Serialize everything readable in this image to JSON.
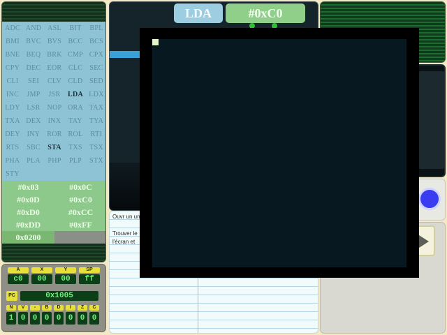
{
  "opcodes": [
    {
      "label": "ADC"
    },
    {
      "label": "AND"
    },
    {
      "label": "ASL"
    },
    {
      "label": "BIT"
    },
    {
      "label": "BPL"
    },
    {
      "label": "BMI"
    },
    {
      "label": "BVC"
    },
    {
      "label": "BVS"
    },
    {
      "label": "BCC"
    },
    {
      "label": "BCS"
    },
    {
      "label": "BNE"
    },
    {
      "label": "BEQ"
    },
    {
      "label": "BRK"
    },
    {
      "label": "CMP"
    },
    {
      "label": "CPX"
    },
    {
      "label": "CPY"
    },
    {
      "label": "DEC"
    },
    {
      "label": "EOR"
    },
    {
      "label": "CLC"
    },
    {
      "label": "SEC"
    },
    {
      "label": "CLI"
    },
    {
      "label": "SEI"
    },
    {
      "label": "CLV"
    },
    {
      "label": "CLD"
    },
    {
      "label": "SED"
    },
    {
      "label": "INC"
    },
    {
      "label": "JMP"
    },
    {
      "label": "JSR"
    },
    {
      "label": "LDA",
      "active": true
    },
    {
      "label": "LDX"
    },
    {
      "label": "LDY"
    },
    {
      "label": "LSR"
    },
    {
      "label": "NOP"
    },
    {
      "label": "ORA"
    },
    {
      "label": "TAX"
    },
    {
      "label": "TXA"
    },
    {
      "label": "DEX"
    },
    {
      "label": "INX"
    },
    {
      "label": "TAY"
    },
    {
      "label": "TYA"
    },
    {
      "label": "DEY"
    },
    {
      "label": "INY"
    },
    {
      "label": "ROR"
    },
    {
      "label": "ROL"
    },
    {
      "label": "RTI"
    },
    {
      "label": "RTS"
    },
    {
      "label": "SBC"
    },
    {
      "label": "STA",
      "active": true
    },
    {
      "label": "TXS"
    },
    {
      "label": "TSX"
    },
    {
      "label": "PHA"
    },
    {
      "label": "PLA"
    },
    {
      "label": "PHP"
    },
    {
      "label": "PLP"
    },
    {
      "label": "STX"
    },
    {
      "label": "STY"
    }
  ],
  "operands": [
    "#0x03",
    "#0x0C",
    "#0x0D",
    "#0xC0",
    "#0xD0",
    "#0xCC",
    "#0xDD",
    "#0xFF"
  ],
  "address": "0x0200",
  "current_instruction": {
    "opcode": "LDA",
    "operand": "#0xC0"
  },
  "registers": {
    "labels": [
      "A",
      "X",
      "Y",
      "SP"
    ],
    "values": [
      "c0",
      "00",
      "00",
      "ff"
    ],
    "pc_label": "PC",
    "pc": "0x1005",
    "flag_labels": [
      "N",
      "V",
      "-",
      "B",
      "D",
      "I",
      "Z",
      "C"
    ],
    "flags": [
      "1",
      "0",
      "0",
      "0",
      "0",
      "0",
      "0",
      "0"
    ]
  },
  "notes": {
    "line1": "Ouvr un un",
    "line2": "Trouver le",
    "line3": "l'écran et"
  },
  "colors": {
    "opcode_bg": "#8ec3d6",
    "operand_bg": "#8cc98a",
    "screen_bg": "#081820",
    "pixel": "#e4f4cc",
    "button": "#3a3cf0"
  },
  "icons": {
    "play": "play-icon",
    "button": "blue-round-button"
  }
}
